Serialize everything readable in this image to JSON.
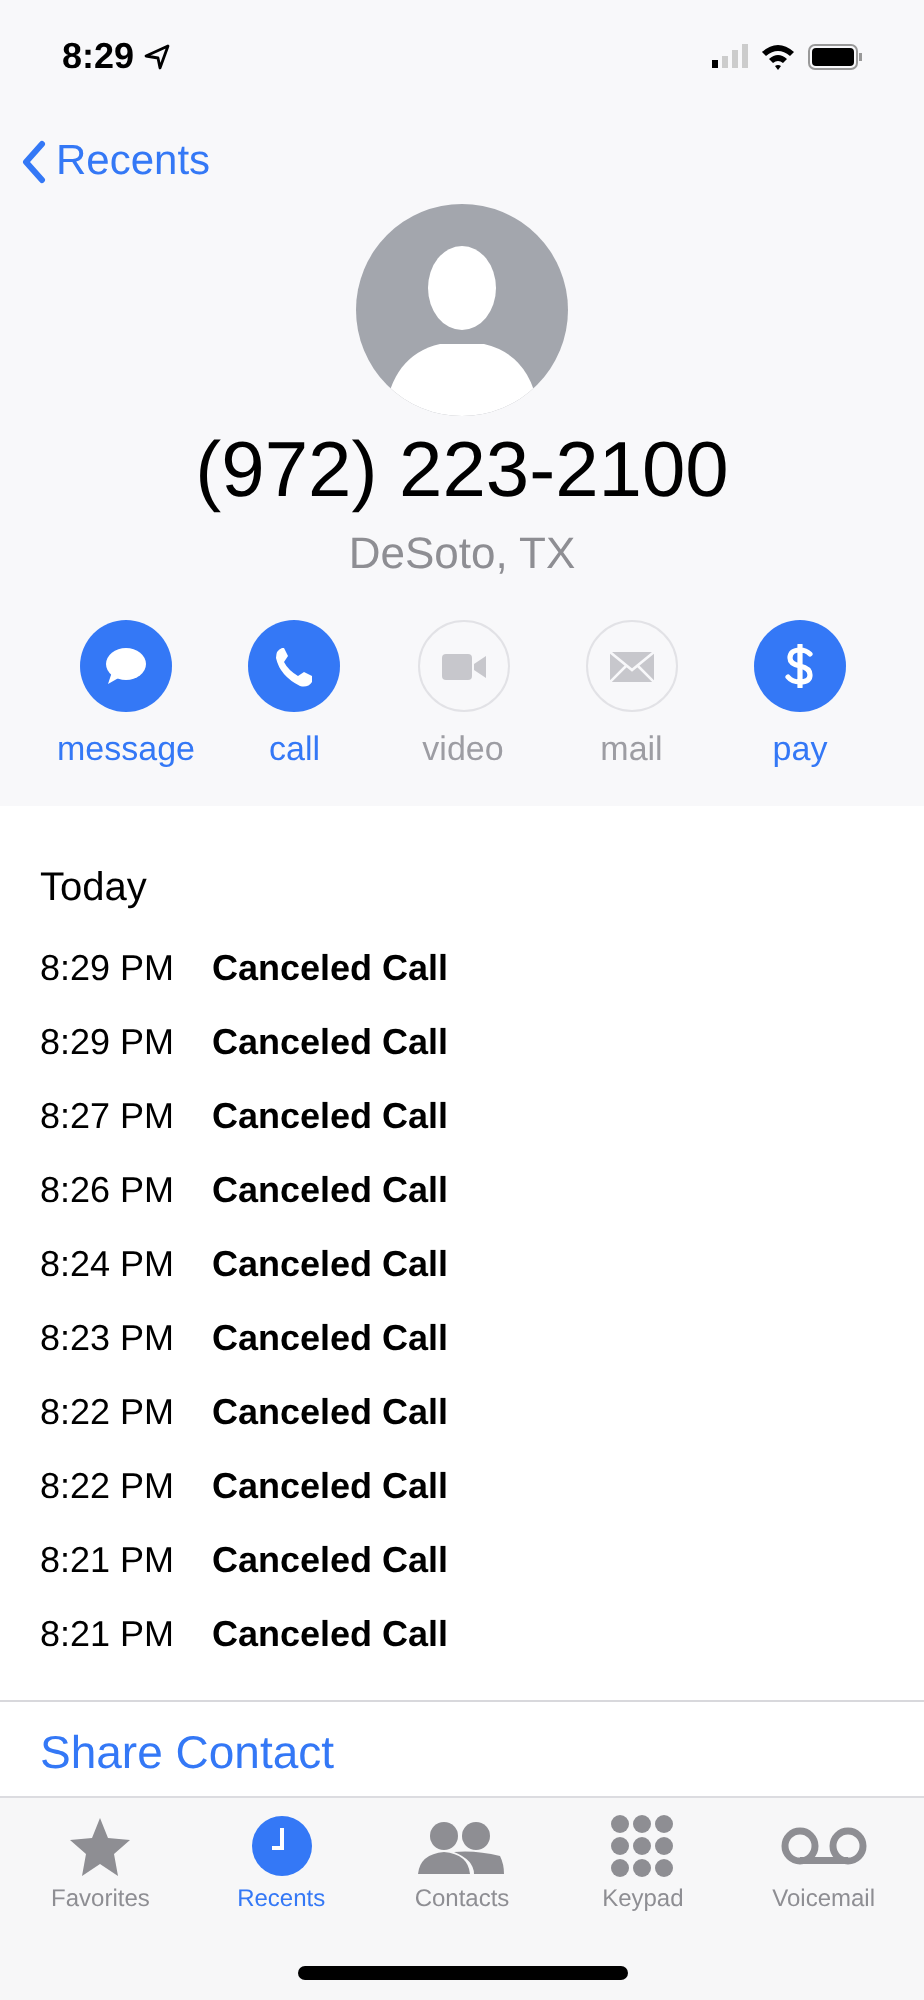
{
  "status_bar": {
    "time": "8:29"
  },
  "nav": {
    "back": "Recents"
  },
  "contact": {
    "number": "(972) 223-2100",
    "location": "DeSoto, TX"
  },
  "actions": [
    {
      "kind": "message",
      "label": "message",
      "enabled": true
    },
    {
      "kind": "call",
      "label": "call",
      "enabled": true
    },
    {
      "kind": "video",
      "label": "video",
      "enabled": false
    },
    {
      "kind": "mail",
      "label": "mail",
      "enabled": false
    },
    {
      "kind": "pay",
      "label": "pay",
      "enabled": true
    }
  ],
  "history": {
    "heading": "Today",
    "rows": [
      {
        "time": "8:29 PM",
        "type": "Canceled Call"
      },
      {
        "time": "8:29 PM",
        "type": "Canceled Call"
      },
      {
        "time": "8:27 PM",
        "type": "Canceled Call"
      },
      {
        "time": "8:26 PM",
        "type": "Canceled Call"
      },
      {
        "time": "8:24 PM",
        "type": "Canceled Call"
      },
      {
        "time": "8:23 PM",
        "type": "Canceled Call"
      },
      {
        "time": "8:22 PM",
        "type": "Canceled Call"
      },
      {
        "time": "8:22 PM",
        "type": "Canceled Call"
      },
      {
        "time": "8:21 PM",
        "type": "Canceled Call"
      },
      {
        "time": "8:21 PM",
        "type": "Canceled Call"
      }
    ]
  },
  "share": "Share Contact",
  "tabs": [
    {
      "kind": "favorites",
      "label": "Favorites",
      "selected": false
    },
    {
      "kind": "recents",
      "label": "Recents",
      "selected": true
    },
    {
      "kind": "contacts",
      "label": "Contacts",
      "selected": false
    },
    {
      "kind": "keypad",
      "label": "Keypad",
      "selected": false
    },
    {
      "kind": "voicemail",
      "label": "Voicemail",
      "selected": false
    }
  ]
}
